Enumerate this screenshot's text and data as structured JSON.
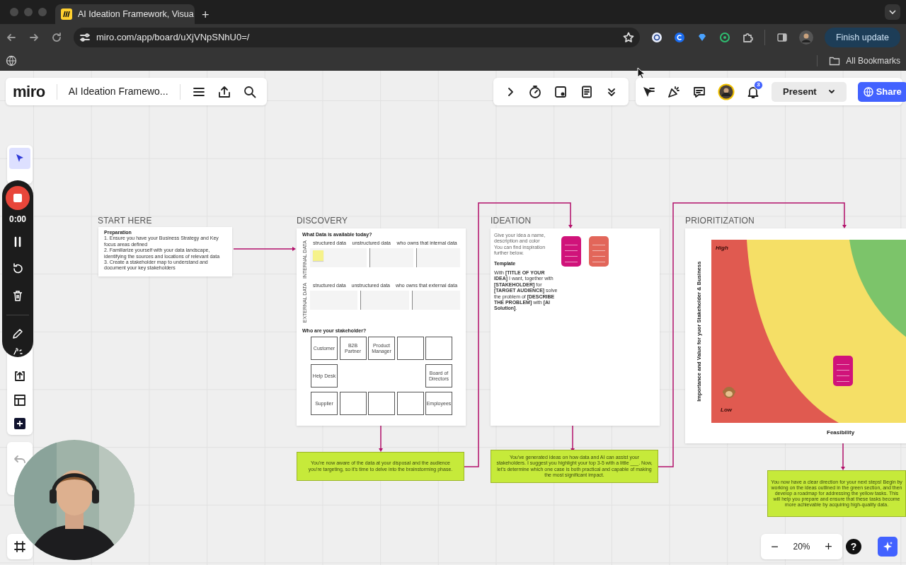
{
  "browser": {
    "tab_title": "AI Ideation Framework, Visua",
    "new_tab": "+",
    "url": "miro.com/app/board/uXjVNpSNhU0=/",
    "update_button": "Finish update",
    "bookmarks_folder": "All Bookmarks"
  },
  "board_header": {
    "logo": "miro",
    "title": "AI Ideation Framewo..."
  },
  "collab_bar": {
    "notification_count": "3",
    "present_button": "Present",
    "share_button": "Share"
  },
  "left_toolbar": {
    "select_tool_selected": true,
    "recording_time": "0:00"
  },
  "start_here": {
    "heading": "START HERE",
    "card_title": "Preparation",
    "steps": [
      "1. Ensure you have your Business Strategy and Key focus areas defined",
      "2. Familiarize yourself with your data landscape, identifying the sources and locations of relevant data",
      "3. Create a stakeholder map to understand and document your key stakeholders"
    ]
  },
  "discovery": {
    "heading": "DISCOVERY",
    "data_title": "What Data is available today?",
    "data_blocks": [
      {
        "side_label": "INTERNAL DATA",
        "columns": [
          "structured data",
          "unstructured data",
          "who owns that internal data"
        ],
        "has_sticky": true
      },
      {
        "side_label": "EXTERNAL DATA",
        "columns": [
          "structured data",
          "unstructured data",
          "who owns that external data"
        ],
        "has_sticky": false
      }
    ],
    "stakeholder_title": "Who are your stakeholder?",
    "stakeholder_rows": [
      {
        "kind": "full",
        "boxes": [
          {
            "kind": "label",
            "label": "Customer"
          },
          {
            "kind": "label",
            "label": "B2B Partner"
          },
          {
            "kind": "label",
            "label": "Product Manager"
          },
          {
            "kind": "empty"
          },
          {
            "kind": "empty"
          }
        ]
      },
      {
        "kind": "edges",
        "boxes": [
          {
            "kind": "label",
            "label": "Help Desk"
          },
          {
            "kind": "label",
            "label": "Board of Directors"
          }
        ]
      },
      {
        "kind": "full",
        "boxes": [
          {
            "kind": "label",
            "label": "Supplier"
          },
          {
            "kind": "empty"
          },
          {
            "kind": "empty"
          },
          {
            "kind": "empty"
          },
          {
            "kind": "label",
            "label": "Employees"
          }
        ]
      }
    ],
    "summary": "You're now aware of the data at your disposal and the audience you're targeting, so it's time to delve into the brainstorming phase."
  },
  "ideation": {
    "heading": "IDEATION",
    "intro": [
      "Give your idea a name, description and color",
      "You can find inspiration further below."
    ],
    "template_title": "Template",
    "template": "With **[TITLE OF YOUR IDEA]** I want, together with **[STAKEHOLDER]** for **[TARGET AUDIENCE]** solve the problem of **[DESCRIBE THE PROBLEM]** with **[AI Solution]**.",
    "sticky_notes": [
      {
        "color": "#d0137a"
      },
      {
        "color": "#e2665a"
      }
    ],
    "summary": "You've generated ideas on how data and AI can assist your stakeholders. I suggest you highlight your top 3-5 with a little ___. Now, let's determine which one case is both practical and capable of making the most significant impact."
  },
  "prioritization": {
    "heading": "PRIORITIZATION",
    "y_axis": "Importance and Value for yuor Stakeholder & Business",
    "x_axis": "Feasibility",
    "high_label": "High",
    "low_label": "Low",
    "sticky_notes": [
      {
        "color": "#d0137a"
      }
    ],
    "summary": "You now have a clear direction for your next steps! Begin by working on the ideas outlined in the green section, and then develop a roadmap for addressing the yellow tasks. This will help you prepare and ensure that these tasks become more achievable by acquiring high-quality data."
  },
  "zoom_controls": {
    "zoom_out": "−",
    "zoom_level": "20%",
    "zoom_in": "+",
    "help": "?"
  }
}
